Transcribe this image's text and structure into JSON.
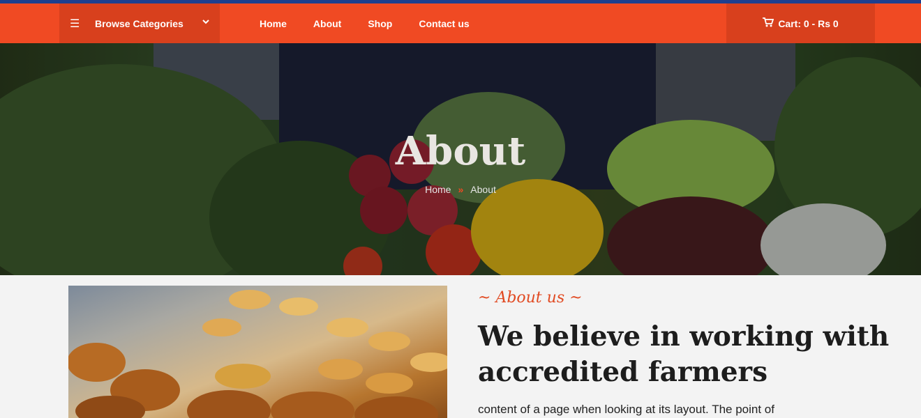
{
  "nav": {
    "browse_label": "Browse Categories",
    "menu": [
      {
        "label": "Home"
      },
      {
        "label": "About"
      },
      {
        "label": "Shop"
      },
      {
        "label": "Contact us"
      }
    ],
    "cart_label": "Cart: 0 - Rs 0"
  },
  "hero": {
    "title": "About",
    "breadcrumb": {
      "home": "Home",
      "current": "About"
    }
  },
  "about": {
    "kicker": "~ About us ~",
    "headline": "We believe in working with accredited farmers",
    "body": "content of a page when looking at its layout. The point of"
  },
  "colors": {
    "accent": "#f04a23",
    "accent_dark": "#d8401d",
    "top_line": "#1e3f8f"
  }
}
